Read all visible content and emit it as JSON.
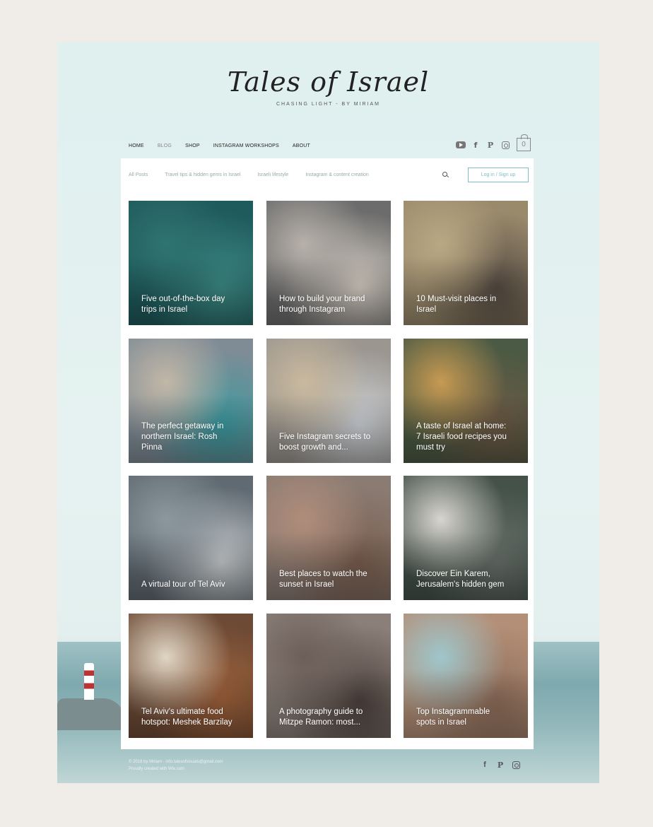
{
  "logo": {
    "name": "Tales of Israel",
    "tagline": "CHASING LIGHT - BY MIRIAM"
  },
  "nav": {
    "items": [
      "HOME",
      "BLOG",
      "SHOP",
      "INSTAGRAM WORKSHOPS",
      "ABOUT"
    ],
    "active": "BLOG"
  },
  "social_icons": [
    "youtube-icon",
    "facebook-icon",
    "pinterest-icon",
    "instagram-icon"
  ],
  "cart": {
    "count": "0"
  },
  "filters": [
    "All Posts",
    "Travel tips & hidden gems in Israel",
    "Israeli lifestyle",
    "Instagram & content creation"
  ],
  "login": {
    "label": "Log in / Sign up"
  },
  "posts": [
    {
      "title": "Five out-of-the-box day trips in Israel",
      "colors": [
        "#1f5a5c",
        "#2f7470",
        "#3d8c86"
      ]
    },
    {
      "title": "How to build your brand through Instagram",
      "colors": [
        "#6c6c6c",
        "#b7b1aa",
        "#d7cfc5"
      ]
    },
    {
      "title": "10 Must-visit places in Israel",
      "colors": [
        "#9a8a6c",
        "#b9a883",
        "#564c43"
      ]
    },
    {
      "title": "The perfect getaway in northern Israel: Rosh Pinna",
      "colors": [
        "#7f8c96",
        "#c2b7a7",
        "#3a9aa0"
      ]
    },
    {
      "title": "Five Instagram secrets to boost growth and...",
      "colors": [
        "#9b9690",
        "#c9b99e",
        "#cfd3d8"
      ]
    },
    {
      "title": "A taste of Israel at home: 7 Israeli food recipes you must try",
      "colors": [
        "#4b5a44",
        "#c79a52",
        "#6e5a45"
      ]
    },
    {
      "title": "A virtual tour of Tel Aviv",
      "colors": [
        "#606a72",
        "#8c979e",
        "#c8ccce"
      ]
    },
    {
      "title": "Best places to watch the sunset in Israel",
      "colors": [
        "#8a7b73",
        "#b08d7a",
        "#7a5e4f"
      ]
    },
    {
      "title": "Discover Ein Karem, Jerusalem's hidden gem",
      "colors": [
        "#44524a",
        "#d8d5cf",
        "#69716b"
      ]
    },
    {
      "title": "Tel Aviv's ultimate food hotspot: Meshek Barzilay",
      "colors": [
        "#6d4a35",
        "#e0d6c4",
        "#a0623b"
      ]
    },
    {
      "title": "A photography guide to Mitzpe Ramon: most...",
      "colors": [
        "#8b8079",
        "#6c5e59",
        "#4d423e"
      ]
    },
    {
      "title": "Top Instagrammable spots in Israel",
      "colors": [
        "#b48f77",
        "#9ec6cc",
        "#8f6e5b"
      ]
    }
  ],
  "footer": {
    "copy_line1": "© 2018 by Miriam - info.talesofvisuals@gmail.com",
    "copy_line2": "Proudly created with Wix.com"
  }
}
